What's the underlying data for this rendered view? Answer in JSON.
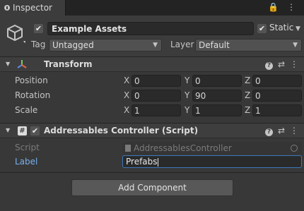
{
  "window": {
    "tab_label": "Inspector",
    "tab_icons": "🔒 ⋮"
  },
  "header": {
    "name": "Example Assets",
    "active_checked": "✔",
    "static_label": "Static",
    "static_checked": "✔",
    "tag_label": "Tag",
    "tag_value": "Untagged",
    "layer_label": "Layer",
    "layer_value": "Default"
  },
  "transform": {
    "title": "Transform",
    "rows": [
      {
        "label": "Position",
        "x": "0",
        "y": "0",
        "z": "0"
      },
      {
        "label": "Rotation",
        "x": "0",
        "y": "90",
        "z": "0"
      },
      {
        "label": "Scale",
        "x": "1",
        "y": "1",
        "z": "1"
      }
    ],
    "axes": {
      "x": "X",
      "y": "Y",
      "z": "Z"
    }
  },
  "script_component": {
    "title": "Addressables Controller (Script)",
    "enabled_checked": "✔",
    "script_label": "Script",
    "script_value": "AddressablesController",
    "label_label": "Label",
    "label_value": "Prefabs"
  },
  "footer": {
    "add_component_label": "Add Component"
  },
  "colors": {
    "background": "#383838",
    "tabbar": "#232323",
    "field": "#2a2a2a",
    "accent_focus": "#3a79bb",
    "label_highlight": "#7ab0ef"
  },
  "icons": {
    "tab": "info-icon",
    "lock": "lock-icon",
    "menu": "kebab-menu-icon",
    "object": "gameobject-cube-icon",
    "transform": "transform-axes-icon",
    "script": "csharp-script-icon",
    "help": "help-icon",
    "preset": "preset-sliders-icon",
    "more": "more-vertical-icon",
    "target": "object-picker-icon"
  }
}
